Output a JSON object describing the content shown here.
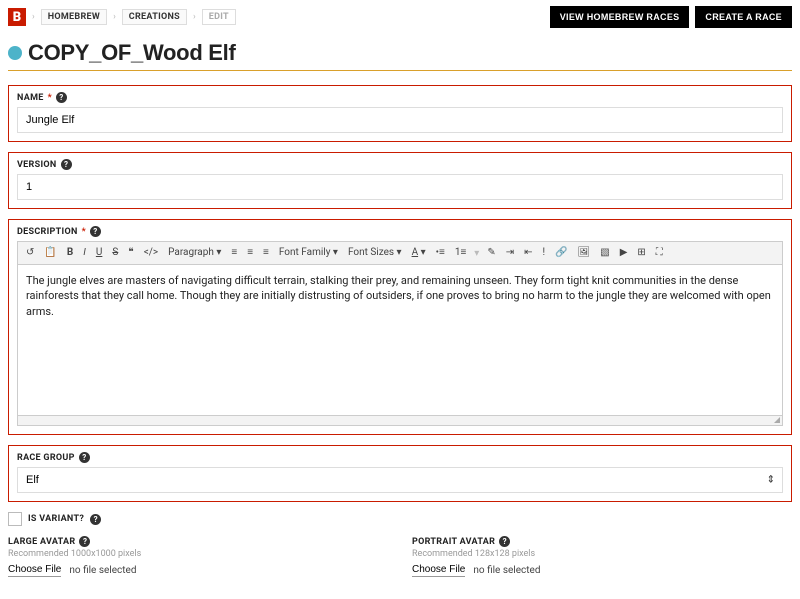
{
  "breadcrumb": {
    "logo": "B",
    "items": [
      "HOMEBREW",
      "CREATIONS",
      "EDIT"
    ]
  },
  "topButtons": {
    "view": "VIEW HOMEBREW RACES",
    "create": "CREATE A RACE"
  },
  "page": {
    "title": "COPY_OF_Wood Elf"
  },
  "name": {
    "label": "NAME",
    "value": "Jungle Elf"
  },
  "version": {
    "label": "VERSION",
    "value": "1"
  },
  "description": {
    "label": "DESCRIPTION",
    "value": "The jungle elves are masters of navigating difficult terrain, stalking their prey, and remaining unseen. They form tight knit communities in the dense rainforests that they call home. Though they are initially distrusting of outsiders, if one proves to bring no harm to the jungle they are welcomed with open arms.",
    "toolbar": {
      "format": "Paragraph",
      "fontFamily": "Font Family",
      "fontSizes": "Font Sizes"
    }
  },
  "raceGroup": {
    "label": "RACE GROUP",
    "value": "Elf"
  },
  "variant": {
    "label": "IS VARIANT?"
  },
  "largeAvatar": {
    "label": "LARGE AVATAR",
    "hint": "Recommended 1000x1000 pixels",
    "btn": "Choose File",
    "state": "no file selected"
  },
  "portraitAvatar": {
    "label": "PORTRAIT AVATAR",
    "hint": "Recommended 128x128 pixels",
    "btn": "Choose File",
    "state": "no file selected"
  }
}
